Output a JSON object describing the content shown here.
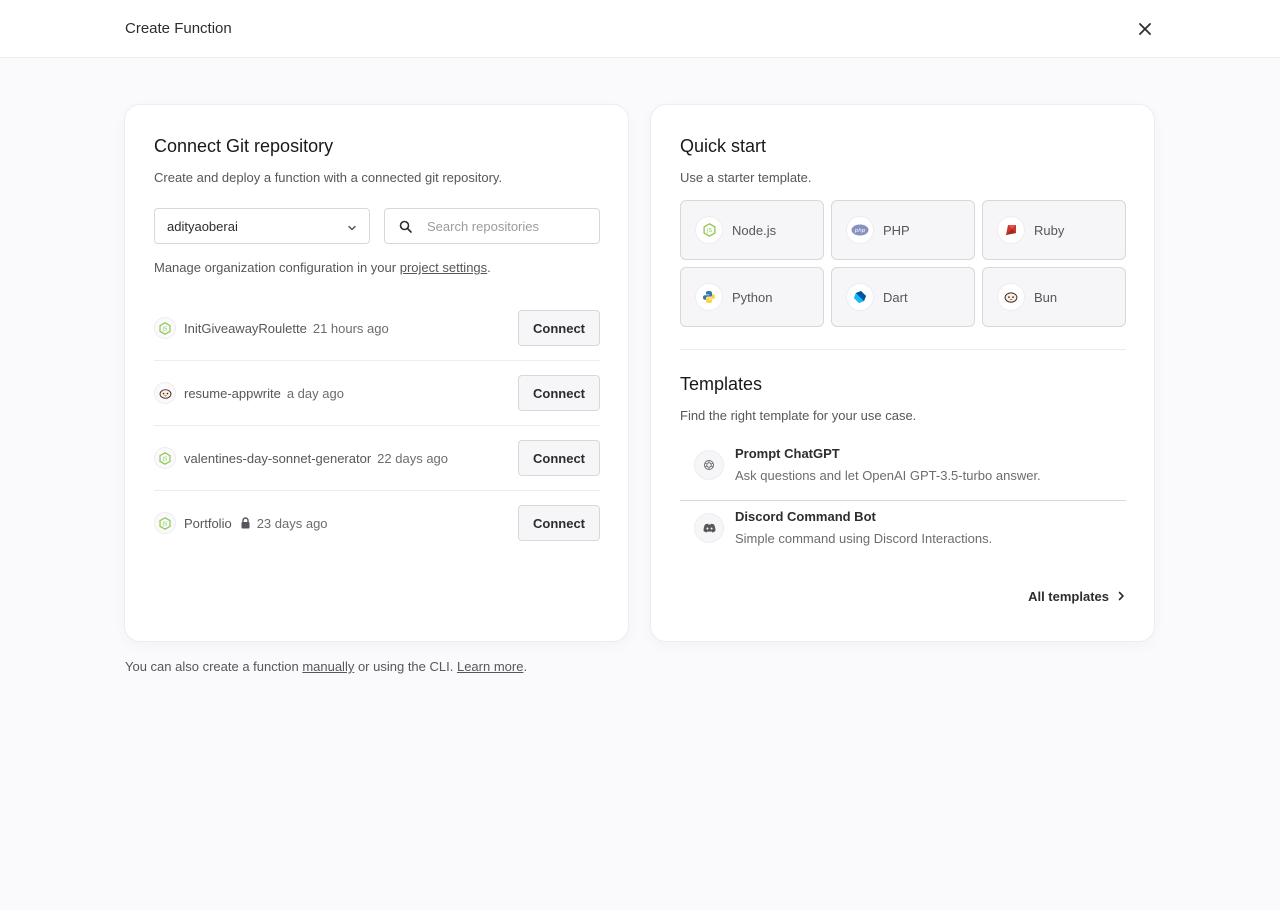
{
  "header": {
    "title": "Create Function",
    "close_icon": "close-icon"
  },
  "git": {
    "title": "Connect Git repository",
    "subtitle": "Create and deploy a function with a connected git repository.",
    "account": "adityaoberai",
    "search_placeholder": "Search repositories",
    "manage_prefix": "Manage organization configuration in your ",
    "manage_link": "project settings",
    "manage_suffix": ".",
    "connect_label": "Connect",
    "repos": [
      {
        "name": "InitGiveawayRoulette",
        "time": "21 hours ago",
        "icon": "nodejs-icon",
        "private": false
      },
      {
        "name": "resume-appwrite",
        "time": "a day ago",
        "icon": "bun-icon",
        "private": false
      },
      {
        "name": "valentines-day-sonnet-generator",
        "time": "22 days ago",
        "icon": "nodejs-icon",
        "private": false
      },
      {
        "name": "Portfolio",
        "time": "23 days ago",
        "icon": "nodejs-icon",
        "private": true
      }
    ]
  },
  "quickstart": {
    "title": "Quick start",
    "subtitle": "Use a starter template.",
    "runtimes": [
      {
        "label": "Node.js",
        "icon": "nodejs-icon"
      },
      {
        "label": "PHP",
        "icon": "php-icon"
      },
      {
        "label": "Ruby",
        "icon": "ruby-icon"
      },
      {
        "label": "Python",
        "icon": "python-icon"
      },
      {
        "label": "Dart",
        "icon": "dart-icon"
      },
      {
        "label": "Bun",
        "icon": "bun-icon"
      }
    ]
  },
  "templates": {
    "title": "Templates",
    "subtitle": "Find the right template for your use case.",
    "items": [
      {
        "name": "Prompt ChatGPT",
        "desc": "Ask questions and let OpenAI GPT-3.5-turbo answer.",
        "icon": "openai-icon"
      },
      {
        "name": "Discord Command Bot",
        "desc": "Simple command using Discord Interactions.",
        "icon": "discord-icon"
      }
    ],
    "all_label": "All templates"
  },
  "footer": {
    "prefix": "You can also create a function ",
    "manual_link": "manually",
    "middle": " or using the CLI. ",
    "learn_link": "Learn more",
    "suffix": "."
  }
}
